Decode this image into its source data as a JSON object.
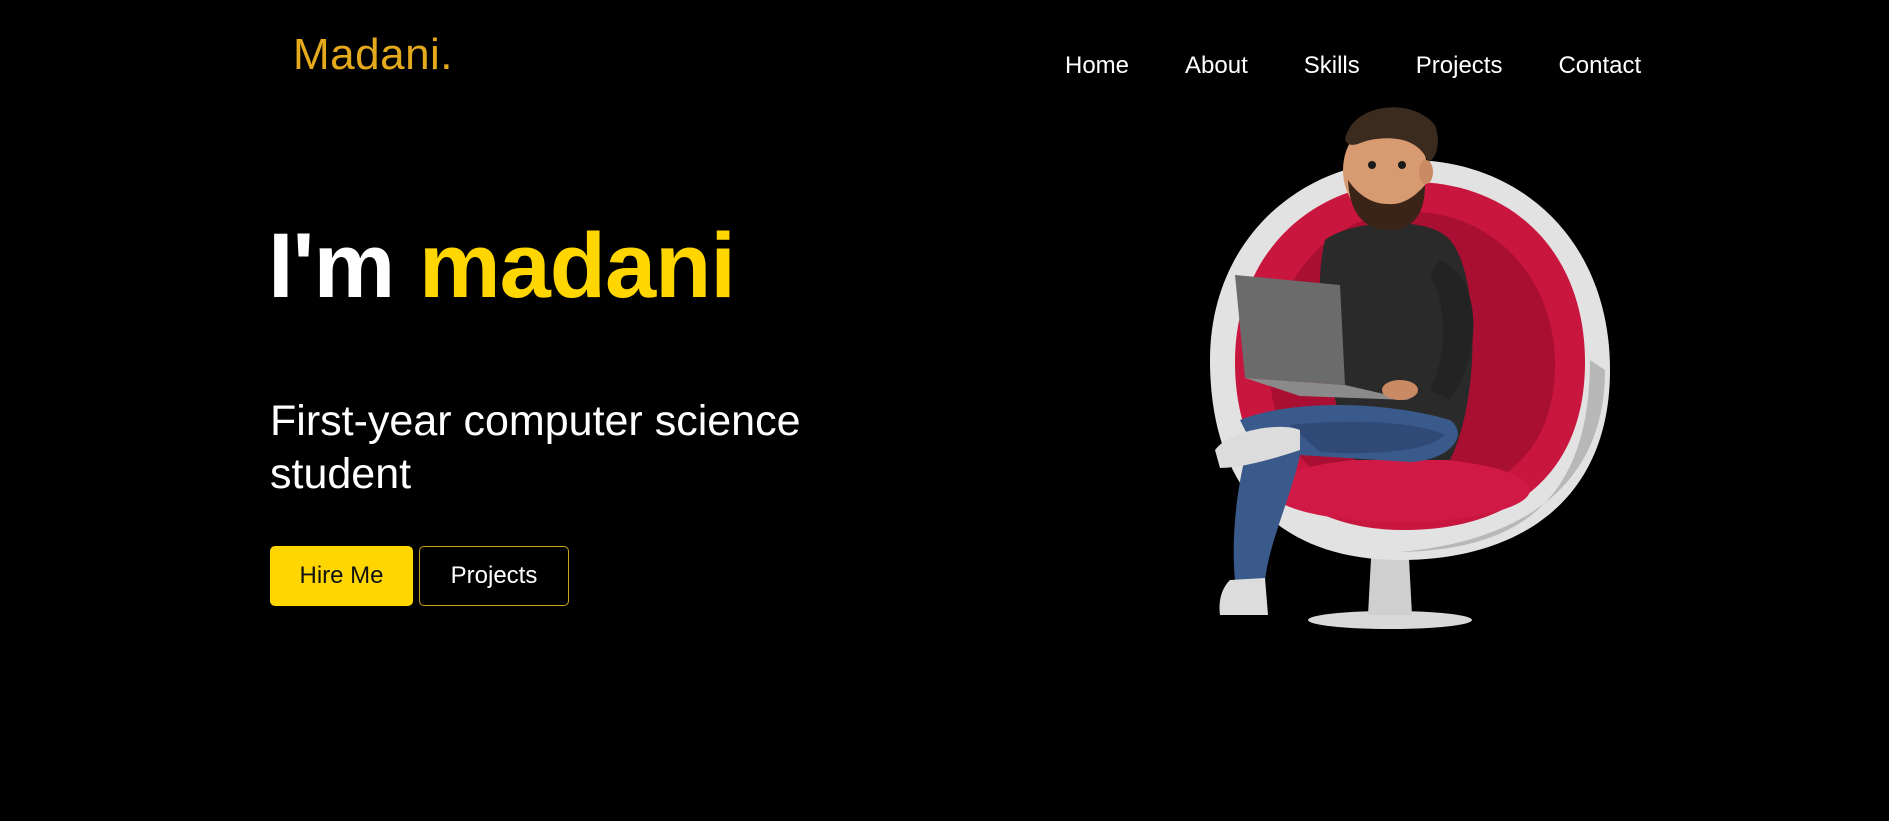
{
  "header": {
    "logo": "Madani."
  },
  "nav": {
    "items": [
      {
        "label": "Home"
      },
      {
        "label": "About"
      },
      {
        "label": "Skills"
      },
      {
        "label": "Projects"
      },
      {
        "label": "Contact"
      }
    ]
  },
  "hero": {
    "greeting": "I'm",
    "name": "madani",
    "subtitle": "First-year computer science student",
    "hire_button": "Hire Me",
    "projects_button": "Projects"
  },
  "colors": {
    "background": "#000000",
    "accent": "#ffd600",
    "logo": "#e5a91c",
    "text": "#ffffff"
  },
  "illustration": {
    "icon": "man-in-egg-chair-with-laptop-illustration"
  }
}
